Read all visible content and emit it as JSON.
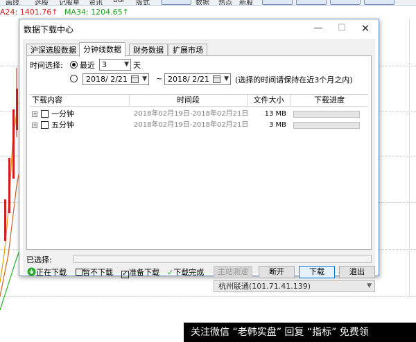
{
  "app": {
    "toolbar_items": [
      "画线",
      "选股",
      "记股星",
      "资讯",
      "ЬЫ",
      "版式",
      "数据",
      "热点",
      "新股"
    ],
    "ma": {
      "ma24": "A24: 1401.76↑",
      "ma34": "MA34: 1204.65↑"
    }
  },
  "dialog": {
    "title": "数据下载中心",
    "controls": {
      "minimize": "—",
      "maximize": "☐",
      "close": "✕"
    },
    "tabs": [
      "沪深选股数据",
      "分钟线数据",
      "财务数据",
      "扩展市场"
    ],
    "active_tab": 1,
    "time_select": {
      "label": "时间选择:",
      "recent_label": "最近",
      "recent_value": "3",
      "days_unit": "天",
      "date_from": "2018/ 2/21",
      "range_sep": "~",
      "date_to": "2018/ 2/21",
      "hint": "(选择的时间请保持在近3个月之内)"
    },
    "table": {
      "headers": [
        "下载内容",
        "时间段",
        "文件大小",
        "下载进度"
      ],
      "rows": [
        {
          "name": "一分钟",
          "period": "2018年02月19日-2018年02月21日",
          "size": "13 MB",
          "progress": 0
        },
        {
          "name": "五分钟",
          "period": "2018年02月19日-2018年02月21日",
          "size": "3 MB",
          "progress": 0
        }
      ]
    },
    "status_label": "已选择:",
    "legend": {
      "downloading": "正在下载",
      "paused": "暂不下载",
      "ready": "准备下载",
      "done": "下载完成"
    },
    "buttons": {
      "test_server": "主站测速",
      "disconnect": "断开",
      "download": "下载",
      "exit": "退出"
    },
    "server": "杭州联通(101.71.41.139)"
  },
  "watermark": "关注微信 “老韩实盘” 回复 “指标” 免费领"
}
